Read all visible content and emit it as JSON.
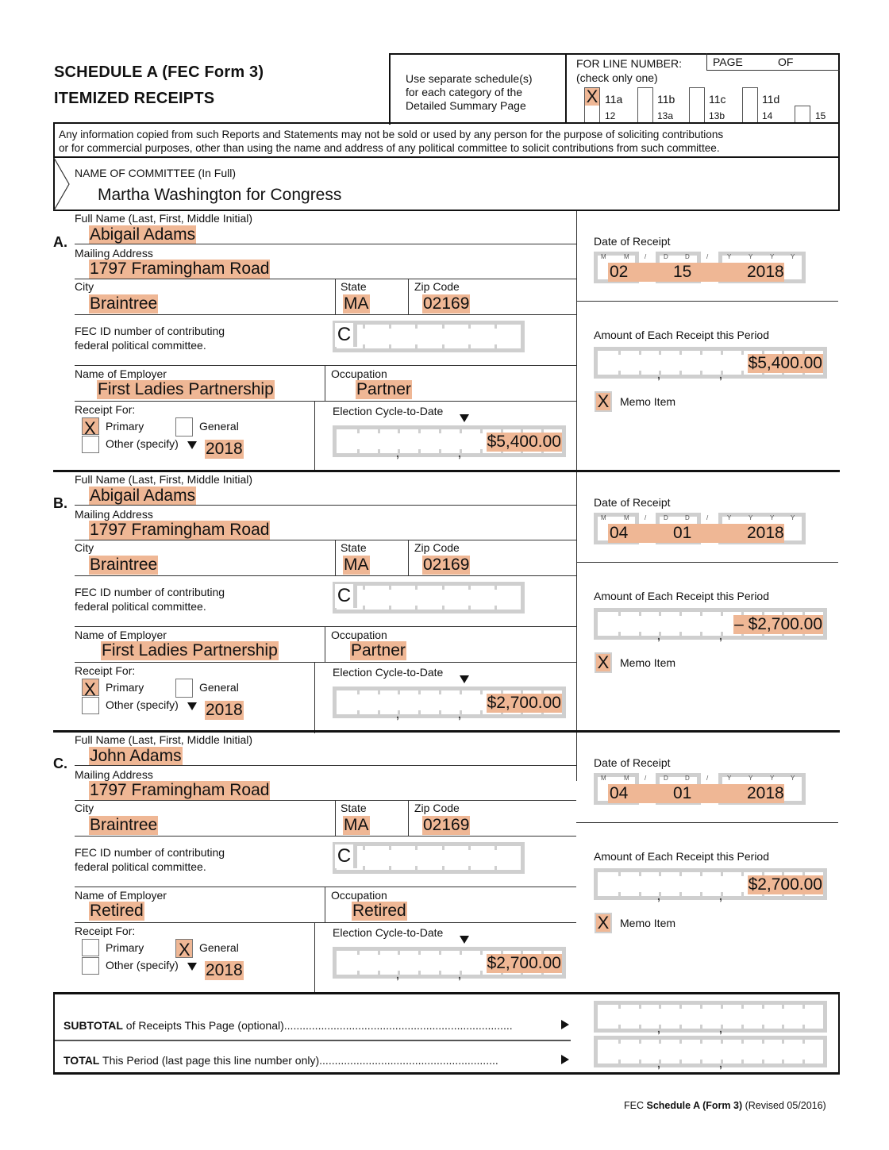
{
  "header": {
    "title_line1": "SCHEDULE A  (FEC Form 3)",
    "title_line2": "ITEMIZED RECEIPTS",
    "instructions_line1": "Use separate schedule(s)",
    "instructions_line2": "for each category of the",
    "instructions_line3": "Detailed Summary Page",
    "line_number_label": "FOR LINE NUMBER:",
    "check_only_one": "(check only one)",
    "page_label": "PAGE",
    "of_label": "OF",
    "line_options": [
      {
        "label": "11a",
        "checked": true,
        "mark": "X"
      },
      {
        "label": "11b",
        "checked": false
      },
      {
        "label": "11c",
        "checked": false
      },
      {
        "label": "11d",
        "checked": false
      },
      {
        "label": "12",
        "checked": false
      },
      {
        "label": "13a",
        "checked": false
      },
      {
        "label": "13b",
        "checked": false
      },
      {
        "label": "14",
        "checked": false
      },
      {
        "label": "15",
        "checked": false
      }
    ]
  },
  "notice": {
    "line1": "Any information copied from such Reports and Statements may not be sold or used by any person for the purpose of soliciting contributions",
    "line2": "or for commercial purposes, other than using the name and address of any political committee to solicit contributions from such committee."
  },
  "committee": {
    "label": "NAME OF COMMITTEE (In Full)",
    "value": "Martha Washington for Congress"
  },
  "labels": {
    "full_name": "Full Name (Last, First, Middle Initial)",
    "mailing_address": "Mailing Address",
    "city": "City",
    "state": "State",
    "zip": "Zip Code",
    "fec_id_line1": "FEC ID number of contributing",
    "fec_id_line2": "federal political committee.",
    "fec_id_prefix": "C",
    "employer": "Name of Employer",
    "occupation": "Occupation",
    "receipt_for": "Receipt For:",
    "primary": "Primary",
    "general": "General",
    "other": "Other (specify)",
    "election_cycle": "Election Cycle-to-Date",
    "date_of_receipt": "Date of Receipt",
    "amount": "Amount of Each Receipt this Period",
    "memo": "Memo Item",
    "mm": "M",
    "dd": "D",
    "yy": "Y",
    "slash": "/",
    "comma": ","
  },
  "entries": [
    {
      "letter": "A.",
      "full_name": "Abigail Adams",
      "address": "1797 Framingham Road",
      "city": "Braintree",
      "state": "MA",
      "zip": "02169",
      "employer": "First Ladies Partnership",
      "occupation": "Partner",
      "primary_mark": "X",
      "general_mark": "",
      "other_year": "2018",
      "cycle_to_date": "$5,400.00",
      "date_mm": "02",
      "date_dd": "15",
      "date_yyyy": "2018",
      "amount": "$5,400.00",
      "memo_mark": "X"
    },
    {
      "letter": "B.",
      "full_name": "Abigail Adams",
      "address": "1797 Framingham Road",
      "city": "Braintree",
      "state": "MA",
      "zip": "02169",
      "employer": "First Ladies Partnership",
      "occupation": "Partner",
      "primary_mark": "X",
      "general_mark": "",
      "other_year": "2018",
      "cycle_to_date": "$2,700.00",
      "date_mm": "04",
      "date_dd": "01",
      "date_yyyy": "2018",
      "amount": "– $2,700.00",
      "memo_mark": "X"
    },
    {
      "letter": "C.",
      "full_name": "John Adams",
      "address": "1797 Framingham Road",
      "city": "Braintree",
      "state": "MA",
      "zip": "02169",
      "employer": "Retired",
      "occupation": "Retired",
      "primary_mark": "",
      "general_mark": "X",
      "other_year": "2018",
      "cycle_to_date": "$2,700.00",
      "date_mm": "04",
      "date_dd": "01",
      "date_yyyy": "2018",
      "amount": "$2,700.00",
      "memo_mark": "X"
    }
  ],
  "totals": {
    "subtotal_bold": "SUBTOTAL",
    "subtotal_rest": " of Receipts This Page (optional)",
    "total_bold": "TOTAL",
    "total_rest": " This Period (last page this line number only)",
    "subtotal_value": "",
    "total_value": ""
  },
  "footer": {
    "prefix": "FEC ",
    "bold": "Schedule A (Form 3)",
    "suffix": " (Revised 05/2016)"
  }
}
